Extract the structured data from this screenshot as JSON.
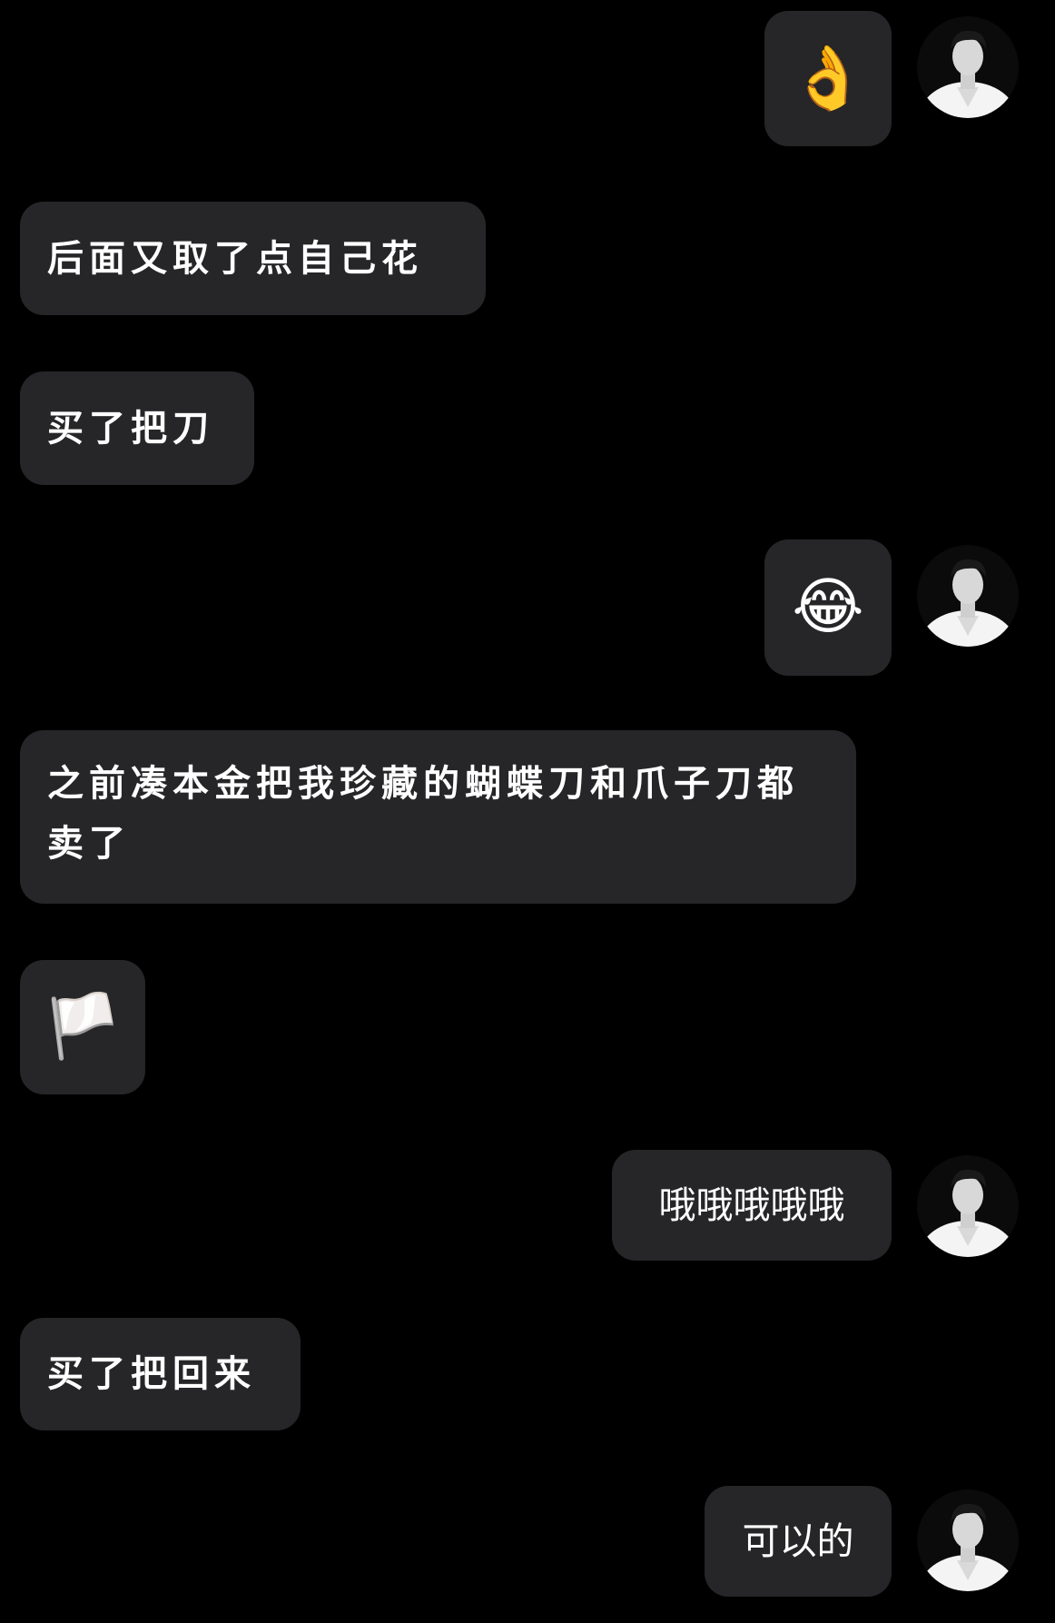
{
  "messages": [
    {
      "side": "right",
      "type": "emoji",
      "content": "👌",
      "emoji_name": "ok-hand"
    },
    {
      "side": "left",
      "type": "text",
      "content": "后面又取了点自己花"
    },
    {
      "side": "left",
      "type": "text",
      "content": "买了把刀"
    },
    {
      "side": "right",
      "type": "emoji",
      "content": "😂",
      "emoji_name": "tears-of-joy"
    },
    {
      "side": "left",
      "type": "text",
      "content": "之前凑本金把我珍藏的蝴蝶刀和爪子刀都卖了"
    },
    {
      "side": "left",
      "type": "emoji",
      "content": "🏳️",
      "emoji_name": "white-flag"
    },
    {
      "side": "right",
      "type": "text",
      "content": "哦哦哦哦哦"
    },
    {
      "side": "left",
      "type": "text",
      "content": "买了把回来"
    },
    {
      "side": "right",
      "type": "text",
      "content": "可以的"
    }
  ],
  "colors": {
    "background": "#000000",
    "bubble": "#262628",
    "text": "#ffffff"
  }
}
